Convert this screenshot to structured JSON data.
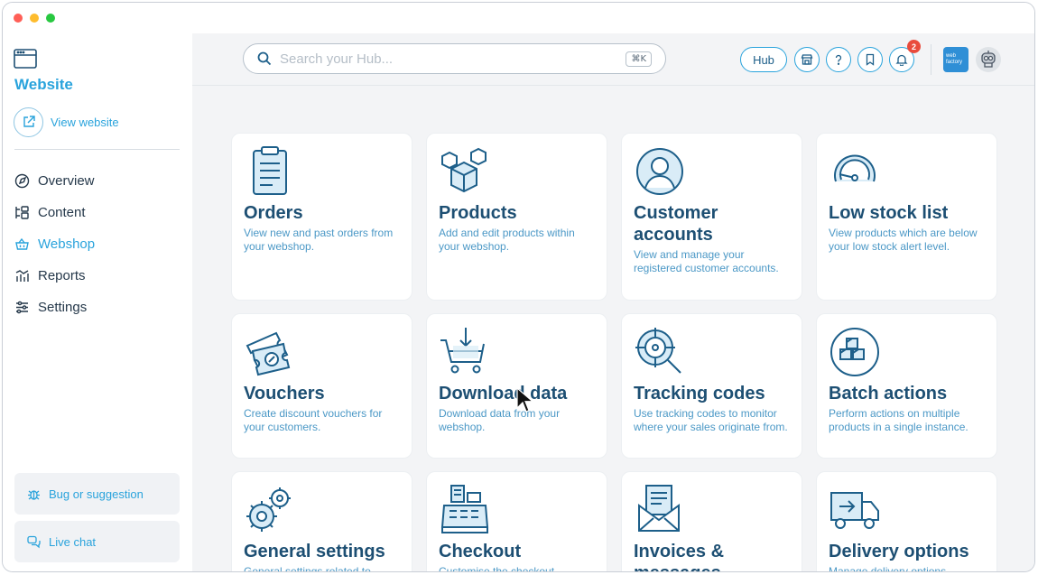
{
  "sidebar": {
    "title": "Website",
    "view_website": "View website",
    "nav": [
      {
        "label": "Overview",
        "icon": "overview-icon"
      },
      {
        "label": "Content",
        "icon": "content-icon"
      },
      {
        "label": "Webshop",
        "icon": "webshop-icon",
        "active": true
      },
      {
        "label": "Reports",
        "icon": "reports-icon"
      },
      {
        "label": "Settings",
        "icon": "settings-icon"
      }
    ],
    "bug_label": "Bug or suggestion",
    "chat_label": "Live chat"
  },
  "topbar": {
    "search_placeholder": "Search your Hub...",
    "shortcut": "⌘K",
    "hub_label": "Hub",
    "notification_count": "2",
    "brand_text": "web factory"
  },
  "colors": {
    "accent": "#29a3dc",
    "title": "#1d4f73",
    "badge": "#e94b3c"
  },
  "cards": [
    {
      "title": "Orders",
      "desc": "View new and past orders from your webshop.",
      "icon": "clipboard-icon"
    },
    {
      "title": "Products",
      "desc": "Add and edit products within your webshop.",
      "icon": "boxes-icon"
    },
    {
      "title": "Customer accounts",
      "desc": "View and manage your registered customer accounts.",
      "icon": "customer-icon"
    },
    {
      "title": "Low stock list",
      "desc": "View products which are below your low stock alert level.",
      "icon": "gauge-icon"
    },
    {
      "title": "Vouchers",
      "desc": "Create discount vouchers for your customers.",
      "icon": "voucher-icon"
    },
    {
      "title": "Download data",
      "desc": "Download data from your webshop.",
      "icon": "cart-download-icon"
    },
    {
      "title": "Tracking codes",
      "desc": "Use tracking codes to monitor where your sales originate from.",
      "icon": "tracking-icon"
    },
    {
      "title": "Batch actions",
      "desc": "Perform actions on multiple products in a single instance.",
      "icon": "batch-icon"
    },
    {
      "title": "General settings",
      "desc": "General settings related to",
      "icon": "gears-icon"
    },
    {
      "title": "Checkout",
      "desc": "Customise the checkout",
      "icon": "register-icon"
    },
    {
      "title": "Invoices & messages",
      "desc": "",
      "icon": "invoice-icon"
    },
    {
      "title": "Delivery options",
      "desc": "Manage delivery options",
      "icon": "truck-icon"
    }
  ]
}
